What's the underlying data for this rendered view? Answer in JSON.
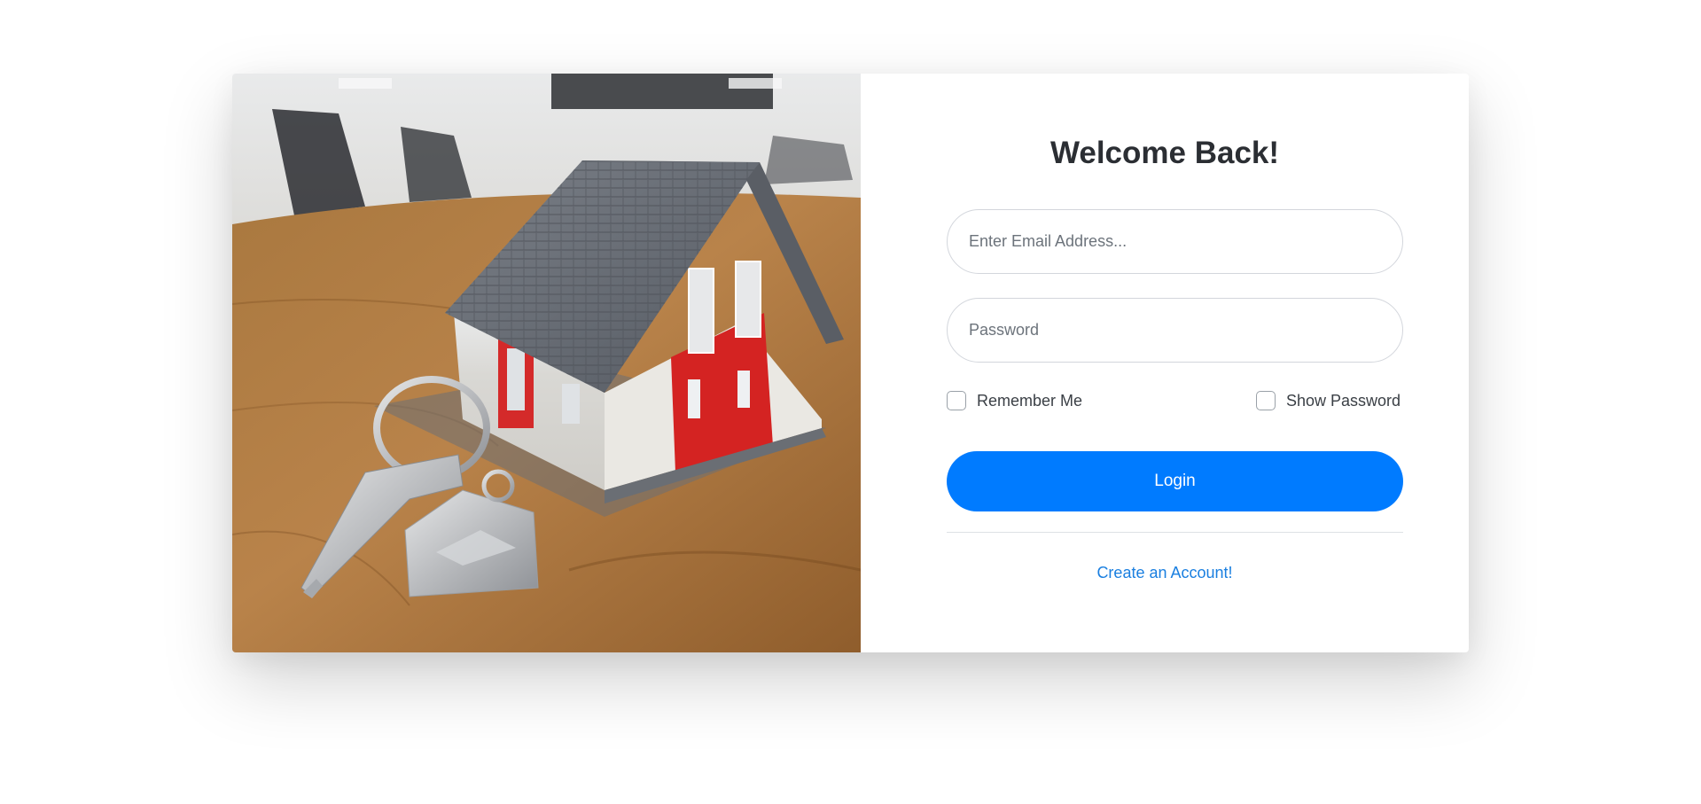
{
  "login": {
    "title": "Welcome Back!",
    "email_placeholder": "Enter Email Address...",
    "password_placeholder": "Password",
    "remember_label": "Remember Me",
    "show_password_label": "Show Password",
    "login_label": "Login",
    "create_account_label": "Create an Account!"
  },
  "colors": {
    "primary": "#007bff",
    "link": "#1a7fe0",
    "title": "#2b2e33"
  },
  "hero_image": {
    "icon": "house-with-keys-photo"
  }
}
